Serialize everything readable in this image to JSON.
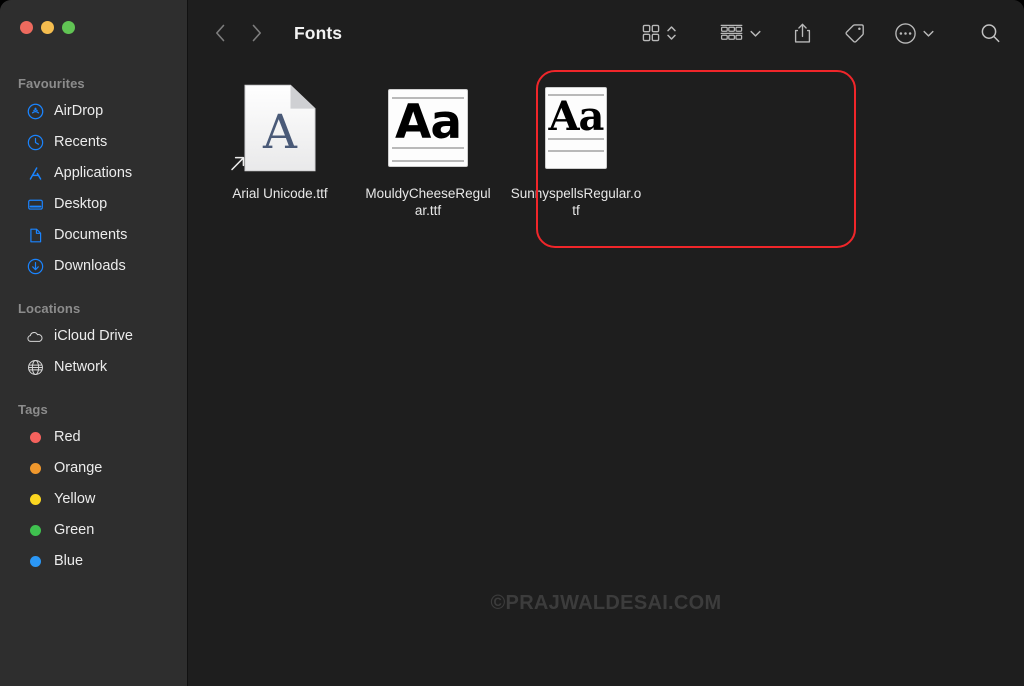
{
  "window": {
    "title": "Fonts",
    "traffic_lights": [
      {
        "name": "close",
        "color": "#ed6a5e"
      },
      {
        "name": "minimize",
        "color": "#f5bd4f"
      },
      {
        "name": "zoom",
        "color": "#61c454"
      }
    ]
  },
  "toolbar": {
    "back_icon": "chevron-left-icon",
    "forward_icon": "chevron-right-icon",
    "title": "Fonts",
    "view_icon": "grid-view-icon",
    "view_sort_icon": "chevron-up-down-icon",
    "group_icon": "group-by-icon",
    "group_chevron_icon": "chevron-down-icon",
    "share_icon": "share-icon",
    "tag_icon": "tag-icon",
    "more_icon": "ellipsis-circle-icon",
    "more_chevron_icon": "chevron-down-icon",
    "search_icon": "search-icon"
  },
  "sidebar": {
    "sections": [
      {
        "title": "Favourites",
        "items": [
          {
            "label": "AirDrop",
            "icon": "airdrop-icon",
            "color": "#1a84ff"
          },
          {
            "label": "Recents",
            "icon": "clock-icon",
            "color": "#1a84ff"
          },
          {
            "label": "Applications",
            "icon": "applications-icon",
            "color": "#1a84ff"
          },
          {
            "label": "Desktop",
            "icon": "desktop-icon",
            "color": "#1a84ff"
          },
          {
            "label": "Documents",
            "icon": "document-icon",
            "color": "#1a84ff"
          },
          {
            "label": "Downloads",
            "icon": "downloads-icon",
            "color": "#1a84ff"
          }
        ]
      },
      {
        "title": "Locations",
        "items": [
          {
            "label": "iCloud Drive",
            "icon": "cloud-icon",
            "color": "#d5d5d5"
          },
          {
            "label": "Network",
            "icon": "globe-icon",
            "color": "#d5d5d5"
          }
        ]
      },
      {
        "title": "Tags",
        "items": [
          {
            "label": "Red",
            "icon": "tag-dot-icon",
            "color": "#f5625d"
          },
          {
            "label": "Orange",
            "icon": "tag-dot-icon",
            "color": "#f0982d"
          },
          {
            "label": "Yellow",
            "icon": "tag-dot-icon",
            "color": "#fbd620"
          },
          {
            "label": "Green",
            "icon": "tag-dot-icon",
            "color": "#3fc14f"
          },
          {
            "label": "Blue",
            "icon": "tag-dot-icon",
            "color": "#2b97f5"
          }
        ]
      }
    ]
  },
  "files": [
    {
      "name": "Arial Unicode.ttf",
      "icon": "font-document-icon",
      "preview_glyph": "A",
      "is_alias": true,
      "alias_icon": "alias-arrow-icon",
      "selected": false
    },
    {
      "name": "MouldyCheeseRegular.ttf",
      "icon": "font-preview-icon",
      "preview_glyph": "Aa",
      "is_alias": false,
      "selected": false
    },
    {
      "name": "SunnyspellsRegular.otf",
      "icon": "font-preview-icon",
      "preview_glyph": "Aa",
      "is_alias": false,
      "selected": false
    }
  ],
  "annotation": {
    "shape": "rounded-rectangle",
    "color": "#f0262a",
    "encloses": "MouldyCheeseRegular.ttf and SunnyspellsRegular.otf"
  },
  "watermark": {
    "text": "©PRAJWALDESAI.COM",
    "color": "#3c3c3c"
  }
}
